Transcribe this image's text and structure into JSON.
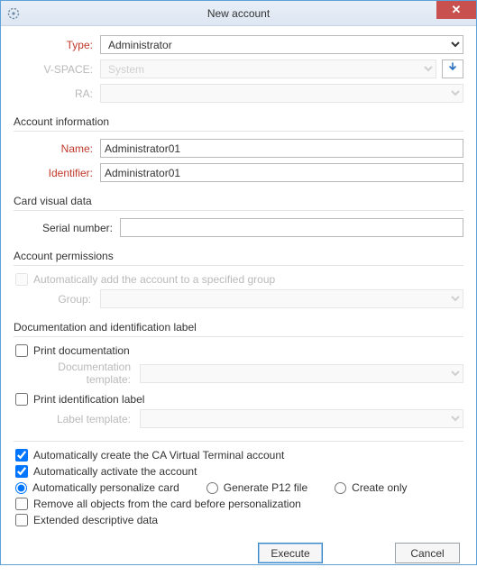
{
  "window": {
    "title": "New account"
  },
  "topfields": {
    "type_label": "Type:",
    "type_value": "Administrator",
    "vspace_label": "V-SPACE:",
    "vspace_value": "System",
    "ra_label": "RA:",
    "ra_value": ""
  },
  "account_info": {
    "section": "Account information",
    "name_label": "Name:",
    "name_value": "Administrator01",
    "identifier_label": "Identifier:",
    "identifier_value": "Administrator01"
  },
  "card_visual": {
    "section": "Card visual data",
    "serial_label": "Serial number:",
    "serial_value": ""
  },
  "permissions": {
    "section": "Account permissions",
    "auto_group_label": "Automatically add the account to a specified group",
    "group_label": "Group:",
    "group_value": ""
  },
  "doc_id": {
    "section": "Documentation and identification label",
    "print_doc_label": "Print documentation",
    "doc_template_label": "Documentation template:",
    "doc_template_value": "",
    "print_id_label": "Print identification label",
    "label_template_label": "Label template:",
    "label_template_value": ""
  },
  "options": {
    "auto_create_ca": "Automatically create the CA Virtual Terminal account",
    "auto_activate": "Automatically activate the account",
    "auto_personalize": "Automatically personalize card",
    "generate_p12": "Generate P12 file",
    "create_only": "Create only",
    "remove_objects": "Remove all objects from the card before personalization",
    "extended_desc": "Extended descriptive data"
  },
  "buttons": {
    "execute": "Execute",
    "cancel": "Cancel"
  }
}
